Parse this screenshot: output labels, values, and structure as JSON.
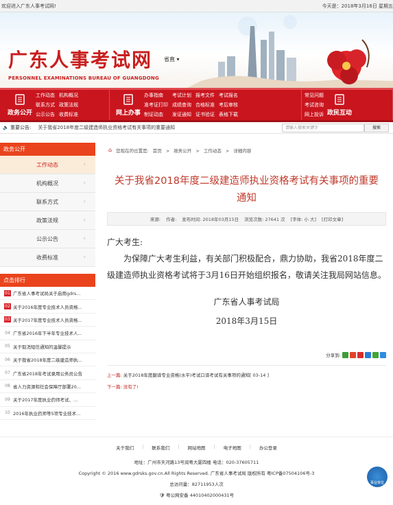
{
  "topbar": {
    "welcome": "欢迎进入广东人事考试网!",
    "date": "今天是：2018年3月16日 星期五"
  },
  "header": {
    "logo_cn": "广东人事考试网",
    "logo_en": "PERSONNEL EXAMINATIONS BUREAU OF GUANGDONG",
    "province": "省直 ▾"
  },
  "nav": {
    "blocks": [
      {
        "head": "政务公开",
        "cols": [
          [
            "工作动态",
            "联系方式",
            "公示公告"
          ],
          [
            "机构概况",
            "政策法规",
            "收费标准"
          ]
        ]
      },
      {
        "head": "网上办事",
        "cols": [
          [
            "办事指南",
            "准考证打印",
            "制证动态"
          ],
          [
            "考试计划",
            "成绩查询",
            "发证通知"
          ],
          [
            "报考文件",
            "合格标准",
            "证书验证"
          ],
          [
            "考试报名",
            "考后审核",
            "表格下载"
          ]
        ]
      },
      {
        "head": "政民互动",
        "cols": [
          [
            "常见问题",
            "考试咨询",
            "网上投诉"
          ]
        ]
      }
    ]
  },
  "notice": {
    "label": "重要公告:",
    "text": "关于我省2018年度二级建造师执业资格考试有关事项的重要通知",
    "search_placeholder": "请输入搜索关键字",
    "search_button": "搜索"
  },
  "sidebar": {
    "title": "政务公开",
    "items": [
      "工作动态",
      "机构概况",
      "联系方式",
      "政策法规",
      "公示公告",
      "收费标准"
    ],
    "rank_title": "点击排行",
    "rank": [
      {
        "n": "01",
        "t": "广东省人事考试局关于启用gdrs..."
      },
      {
        "n": "02",
        "t": "关于2016年度专业技术人员资格..."
      },
      {
        "n": "03",
        "t": "关于2017年度专业技术人员资格..."
      },
      {
        "n": "04",
        "t": "广东省2016年下半年专业技术人..."
      },
      {
        "n": "05",
        "t": "关于取消短信通知的温馨提示"
      },
      {
        "n": "06",
        "t": "关于我省2018年度二级建造师执..."
      },
      {
        "n": "07",
        "t": "广东省2018年考试录用公务员公告"
      },
      {
        "n": "08",
        "t": "省人力资源和社会保障厅部署20..."
      },
      {
        "n": "09",
        "t": "关于2017年度执业药师考试、..."
      },
      {
        "n": "10",
        "t": "2016年执业药师等5项专业技术..."
      }
    ]
  },
  "breadcrumb": {
    "prefix": "您现在的位置是:",
    "items": [
      "首页",
      "政务公开",
      "工作动态",
      "详细内容"
    ]
  },
  "article": {
    "title": "关于我省2018年度二级建造师执业资格考试有关事项的重要通知",
    "meta": {
      "source": "来源:",
      "author": "作者:",
      "time": "发布时间: 2018年03月15日",
      "views": "浏览次数: 27641 次",
      "font": "[字体: 小 大]",
      "print": "[打印文章]"
    },
    "greeting": "广大考生:",
    "para": "为保障广大考生利益，有关部门积极配合，鼎力协助，我省2018年度二级建造师执业资格考试将于3月16日开始组织报名，敬请关注我局网站信息。",
    "org": "广东省人事考试局",
    "date": "2018年3月15日",
    "share": "分享到:",
    "prev_label": "上一篇:",
    "prev": "关于2018年度翻译专业资格(水平)考试口译考试有关事项的通知[ 03-14 ]",
    "next_label": "下一篇:",
    "next": "没有了!"
  },
  "footer": {
    "links": [
      "关于我们",
      "联系我们",
      "网站地图",
      "电子地图",
      "办公登录"
    ],
    "address": "地址：广州市天河路13号润粤大厦四楼 电话：020-37605711",
    "copyright": "Copyright © 2016 www.gdrsks.gov.cn.All Rights Reserved. 广东省人事考试局 版权所有 粤ICP备07504106号-3",
    "visits": "总访问量：82711953人次",
    "police": "粤公网安备 44010402000431号",
    "badge": "事业单位"
  },
  "colors": {
    "brand_red": "#c9151e",
    "accent_orange": "#e9441d",
    "title_red": "#c0392b"
  }
}
